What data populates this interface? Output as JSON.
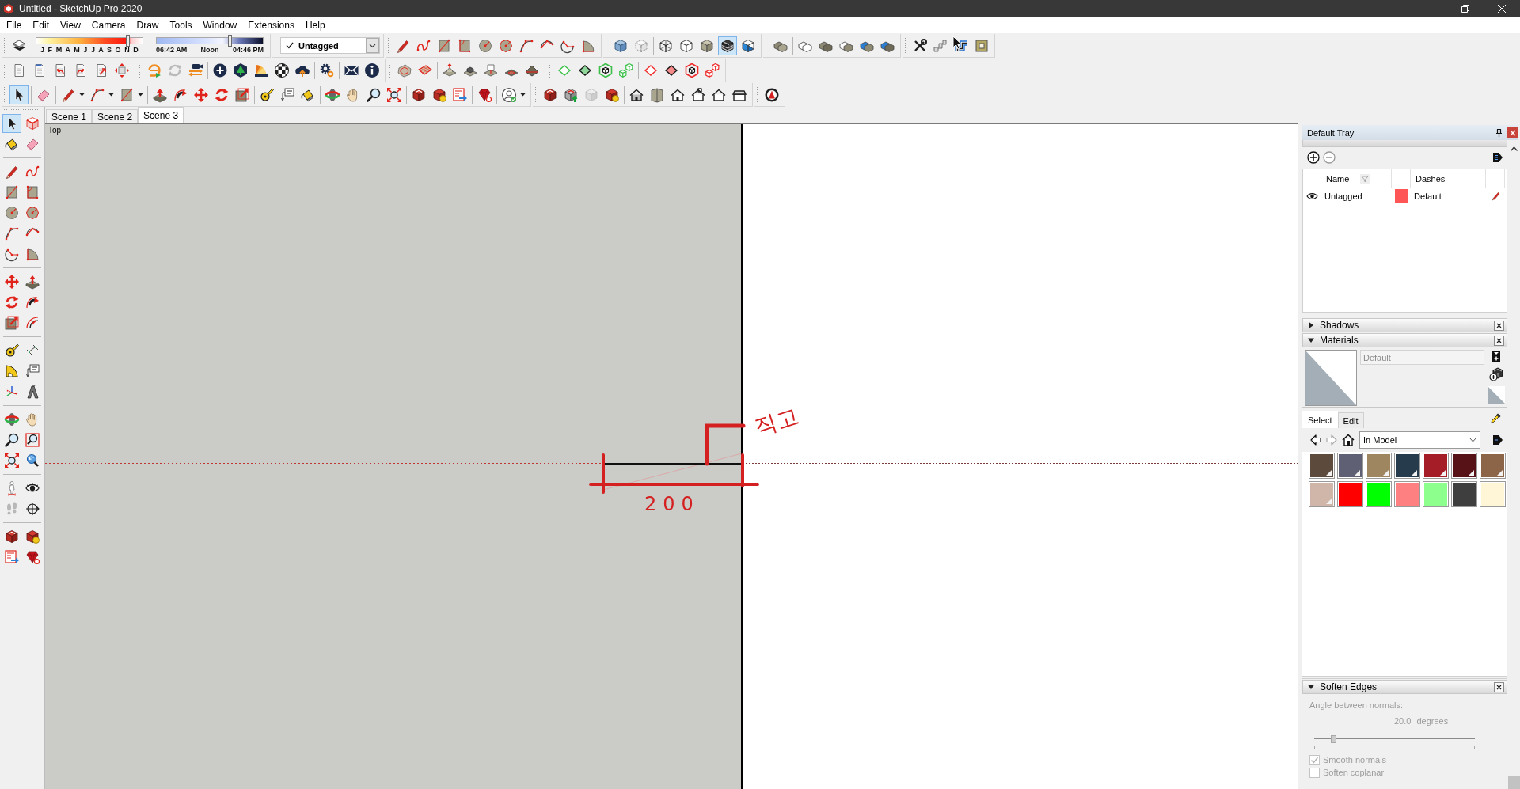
{
  "window": {
    "title": "Untitled - SketchUp Pro 2020"
  },
  "menu": [
    "File",
    "Edit",
    "View",
    "Camera",
    "Draw",
    "Tools",
    "Window",
    "Extensions",
    "Help"
  ],
  "shadow_toolbar": {
    "toggle": {
      "selected": false
    },
    "date_slider": {
      "months": "J F M A M J J A S O N D",
      "level": 0.86
    },
    "time_slider": {
      "start": "06:42 AM",
      "middle": "Noon",
      "end": "04:46 PM",
      "level": 0.69
    }
  },
  "tag_toolbar": {
    "checked": true,
    "value": "Untagged"
  },
  "toolbar_rows": [
    {
      "toolbars": [
        {
          "buttons": [
            {
              "selected": false
            },
            {
              "selected": false
            },
            {
              "selected": false
            },
            {
              "selected": false
            },
            {
              "selected": false
            },
            {
              "selected": false
            },
            {
              "selected": false
            },
            {
              "selected": false
            },
            {
              "selected": false
            },
            {
              "selected": false
            }
          ]
        },
        {
          "buttons": [
            {
              "selected": false
            },
            {
              "selected": false
            },
            {
              "selected": false
            },
            {
              "selected": false
            },
            {
              "selected": false
            },
            {
              "selected": true
            },
            {
              "selected": false
            }
          ]
        },
        {
          "buttons": [
            {
              "selected": false
            },
            {
              "selected": false
            },
            {
              "selected": false
            },
            {
              "selected": false
            },
            {
              "selected": false
            },
            {
              "selected": false
            }
          ]
        },
        {
          "buttons": [
            {
              "selected": false
            },
            {
              "selected": false
            },
            {
              "selected": false
            },
            {
              "selected": false
            }
          ]
        }
      ]
    },
    {
      "toolbars": [
        {
          "buttons": [
            {
              "selected": false
            },
            {
              "selected": false
            },
            {
              "selected": false
            },
            {
              "selected": false
            },
            {
              "selected": false
            },
            {
              "selected": false
            }
          ]
        },
        {
          "buttons": [
            {
              "selected": false
            },
            {
              "selected": false
            },
            {
              "selected": false
            },
            {
              "selected": false
            },
            {
              "selected": false
            },
            {
              "selected": false
            },
            {
              "selected": false
            },
            {
              "selected": false
            },
            {
              "selected": false
            },
            {
              "selected": false
            },
            {
              "selected": false
            }
          ]
        },
        {
          "buttons": [
            {
              "selected": false
            },
            {
              "selected": false
            },
            {
              "selected": false
            },
            {
              "selected": false
            },
            {
              "selected": false
            },
            {
              "selected": false
            },
            {
              "selected": false
            }
          ]
        },
        {
          "buttons": [
            {
              "selected": false
            },
            {
              "selected": false
            },
            {
              "selected": false
            },
            {
              "selected": false
            },
            {
              "selected": false
            },
            {
              "selected": false
            },
            {
              "selected": false
            },
            {
              "selected": false
            }
          ]
        }
      ]
    },
    {
      "toolbars": [
        {
          "buttons": [
            {
              "selected": true
            },
            {
              "selected": false
            },
            {
              "selected": false
            },
            {
              "selected": false
            },
            {
              "selected": false
            },
            {
              "selected": false
            },
            {
              "selected": false
            },
            {
              "selected": false
            },
            {
              "selected": false
            },
            {
              "selected": false
            },
            {
              "selected": false
            },
            {
              "selected": false
            },
            {
              "selected": false
            },
            {
              "selected": false
            },
            {
              "selected": false
            },
            {
              "selected": false
            },
            {
              "selected": false
            },
            {
              "selected": false
            },
            {
              "selected": false
            },
            {
              "selected": false
            },
            {
              "selected": false
            },
            {
              "selected": false
            }
          ]
        },
        {
          "buttons": [
            {
              "selected": false
            },
            {
              "selected": false
            },
            {
              "selected": false
            },
            {
              "selected": false
            },
            {
              "selected": false
            },
            {
              "selected": false
            },
            {
              "selected": false
            },
            {
              "selected": false
            },
            {
              "selected": false
            },
            {
              "selected": false
            }
          ]
        },
        {
          "buttons": [
            {
              "selected": false
            }
          ]
        }
      ]
    }
  ],
  "left_toolbar": {
    "groups": [
      {
        "buttons": [
          {
            "selected": true
          },
          {
            "selected": false
          },
          {
            "selected": false
          },
          {
            "selected": false
          }
        ]
      },
      {
        "buttons": [
          {
            "selected": false
          },
          {
            "selected": false
          },
          {
            "selected": false
          },
          {
            "selected": false
          },
          {
            "selected": false
          },
          {
            "selected": false
          },
          {
            "selected": false
          },
          {
            "selected": false
          },
          {
            "selected": false
          },
          {
            "selected": false
          }
        ]
      },
      {
        "buttons": [
          {
            "selected": false
          },
          {
            "selected": false
          },
          {
            "selected": false
          },
          {
            "selected": false
          },
          {
            "selected": false
          },
          {
            "selected": false
          }
        ]
      },
      {
        "buttons": [
          {
            "selected": false
          },
          {
            "selected": false
          },
          {
            "selected": false
          },
          {
            "selected": false
          },
          {
            "selected": false
          },
          {
            "selected": false
          }
        ]
      },
      {
        "buttons": [
          {
            "selected": false
          },
          {
            "selected": false
          },
          {
            "selected": false
          },
          {
            "selected": false
          },
          {
            "selected": false
          },
          {
            "selected": false
          }
        ]
      },
      {
        "buttons": [
          {
            "selected": false
          },
          {
            "selected": false
          },
          {
            "selected": false
          },
          {
            "selected": false
          }
        ]
      },
      {
        "buttons": [
          {
            "selected": false
          },
          {
            "selected": false
          },
          {
            "selected": false
          },
          {
            "selected": false
          }
        ]
      }
    ]
  },
  "scenes": [
    {
      "label": "Scene 1",
      "selected": false
    },
    {
      "label": "Scene 2",
      "selected": false
    },
    {
      "label": "Scene 3",
      "selected": true
    }
  ],
  "viewport": {
    "view_name": "Top",
    "dimension_note": "200",
    "handwritten_note": "직고"
  },
  "tray": {
    "title": "Default Tray",
    "tags": {
      "columns": [
        "Name",
        "Dashes"
      ],
      "rows": [
        {
          "visible": true,
          "name": "Untagged",
          "color": "#fe5656",
          "dashes": "Default"
        }
      ]
    },
    "shadows": {
      "title": "Shadows",
      "expanded": false
    },
    "materials": {
      "title": "Materials",
      "expanded": true,
      "name": "Default",
      "tabs": [
        {
          "label": "Select",
          "selected": true
        },
        {
          "label": "Edit",
          "selected": false
        }
      ],
      "collection": "In Model",
      "swatches": [
        {
          "color": "#5c4a3c",
          "in_use": true
        },
        {
          "color": "#5f6074",
          "in_use": true
        },
        {
          "color": "#9d8660",
          "in_use": true
        },
        {
          "color": "#263b4b",
          "in_use": true
        },
        {
          "color": "#a51d26",
          "in_use": true
        },
        {
          "color": "#561216",
          "in_use": true
        },
        {
          "color": "#8c6549",
          "in_use": true
        },
        {
          "color": "#d0b6a9",
          "in_use": true
        },
        {
          "color": "#ff0000",
          "in_use": false
        },
        {
          "color": "#00ff00",
          "in_use": false
        },
        {
          "color": "#ff8080",
          "in_use": false
        },
        {
          "color": "#8cff8c",
          "in_use": false
        },
        {
          "color": "#3e3e3e",
          "in_use": false
        },
        {
          "color": "#fff5d7",
          "in_use": false
        }
      ]
    },
    "soften_edges": {
      "title": "Soften Edges",
      "expanded": true,
      "disabled": true,
      "angle_label": "Angle between normals:",
      "angle_value": "20.0",
      "angle_unit": "degrees",
      "level": 0.12,
      "options": [
        {
          "label": "Smooth normals",
          "checked": true
        },
        {
          "label": "Soften coplanar",
          "checked": false
        }
      ]
    }
  }
}
